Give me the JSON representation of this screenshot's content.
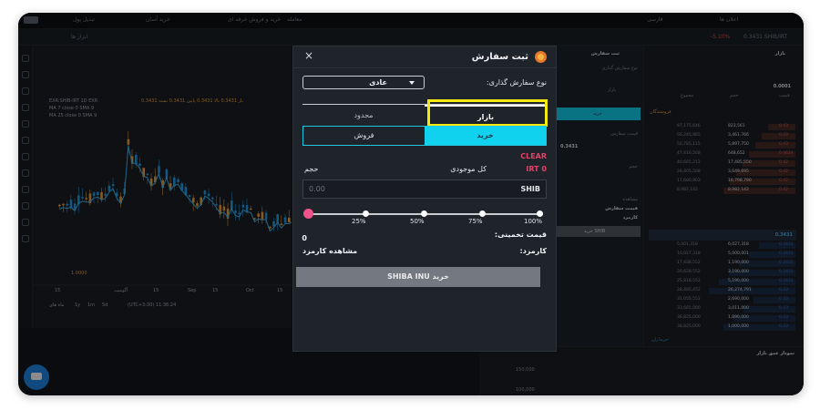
{
  "header": {
    "exchange_text": "ExR",
    "menu_items": [
      "تبدیل پول",
      "خرید آسان",
      "خرید و فروش حرفه ای",
      "معامله"
    ],
    "account_text": "اعلان ها",
    "lang_text": "فارسی"
  },
  "subbar": {
    "left_tab": "ابزار ها",
    "right_text": "0.3431 SHIB/IRT",
    "right_change": "-5.10%"
  },
  "chart": {
    "symbol_legend": "EXR:SHIB-IRT  1D  EXR",
    "ohlc": "باز 0.3431  بالا 0.3431  پایین 0.3431  بسته 0.3431",
    "ma1": "MA 7 close 0 SMA 9",
    "ma2": "MA 25 close 0 SMA 9",
    "price_marker": "1.0000",
    "x_labels": [
      "15",
      "آگوست",
      "15",
      "Sep",
      "15",
      "Oct",
      "15"
    ],
    "bottom_controls": [
      "1y",
      "1m",
      "5d",
      "ماه های"
    ],
    "timezone": "(UTC+3:30)  11:36:24"
  },
  "mid_panel": {
    "title": "ثبت سفارش",
    "order_type_label": "نوع سفارش گذاری",
    "tab": "بازار",
    "button": "خرید",
    "price_label": "قیمت سفارش",
    "price_val": "0.3431",
    "volume_label": "حجم",
    "total_label": "مشاهده",
    "est_label": "قیمت سفارش",
    "fee_label": "کارمزد",
    "buy_btn": "خرید SHIB"
  },
  "right_panel": {
    "title": "بازار",
    "price": "0.0001",
    "col_total": "مجموع",
    "col_volume": "حجم",
    "col_price": "قیمت",
    "sell_label": "فروشندگان",
    "buy_label": "خریداران",
    "last_price": "0.3431",
    "asks": [
      {
        "total": "97,175,646",
        "vol": "823,561",
        "price": "0.43"
      },
      {
        "total": "56,245,965",
        "vol": "3,461,766",
        "price": "0.43"
      },
      {
        "total": "50,785,115",
        "vol": "5,897,750",
        "price": "0.43"
      },
      {
        "total": "47,416,508",
        "vol": "648,652",
        "price": "0.4624"
      },
      {
        "total": "40,665,212",
        "vol": "17,485,550",
        "price": "0.42"
      },
      {
        "total": "28,405,508",
        "vol": "3,649,695",
        "price": "0.42"
      },
      {
        "total": "17,680,903",
        "vol": "10,798,780",
        "price": "0.42"
      },
      {
        "total": "8,982,142",
        "vol": "8,982,142",
        "price": "0.42"
      }
    ],
    "bids": [
      {
        "total": "5,001,318",
        "vol": "6,027,318",
        "price": "0.3431"
      },
      {
        "total": "10,027,318",
        "vol": "5,000,001",
        "price": "0.3431"
      },
      {
        "total": "17,438,552",
        "vol": "1,190,000",
        "price": "0.3431"
      },
      {
        "total": "20,628,552",
        "vol": "3,190,000",
        "price": "0.3431"
      },
      {
        "total": "25,818,552",
        "vol": "5,190,000",
        "price": "0.3431"
      },
      {
        "total": "28,495,452",
        "vol": "26,274,791",
        "price": "0.33"
      },
      {
        "total": "31,055,552",
        "vol": "2,690,000",
        "price": "0.33"
      },
      {
        "total": "33,665,000",
        "vol": "3,011,000",
        "price": "0.33"
      },
      {
        "total": "36,825,000",
        "vol": "1,890,000",
        "price": "0.33"
      },
      {
        "total": "38,825,000",
        "vol": "1,000,000",
        "price": "0.33"
      }
    ]
  },
  "bottom_panel": {
    "title": "نمودار عمق بازار",
    "ticks": [
      "150,000",
      "100,000"
    ]
  },
  "modal": {
    "title": "ثبت سفارش",
    "order_type_label": "نوع سفارش گذاری:",
    "order_type_value": "عادی",
    "tab_market": "بازار",
    "tab_limit": "محدود",
    "buy": "خرید",
    "sell": "فروش",
    "clear": "CLEAR",
    "volume_label": "حجم",
    "balance_label": "کل موجودی",
    "balance_value": "IRT 0",
    "amount_unit": "SHIB",
    "amount_value": "0.00",
    "slider_value_pct": 0,
    "slider_marks": [
      "25%",
      "50%",
      "75%",
      "100%"
    ],
    "estimated_label": "قیمت تخمینی:",
    "estimated_value": "0",
    "fee_label": "کارمزد:",
    "fee_link": "مشاهده کارمزد",
    "submit": "خرید SHIBA INU",
    "close": "×"
  },
  "colors": {
    "accent_cyan": "#11d2ee",
    "clear_pink": "#e2436a",
    "highlight_yellow": "#f4ea11",
    "ask_red": "#e05454",
    "bid_blue": "#2f6fd6",
    "candle_up": "#1ea0e8",
    "candle_down": "#f2a33a"
  }
}
